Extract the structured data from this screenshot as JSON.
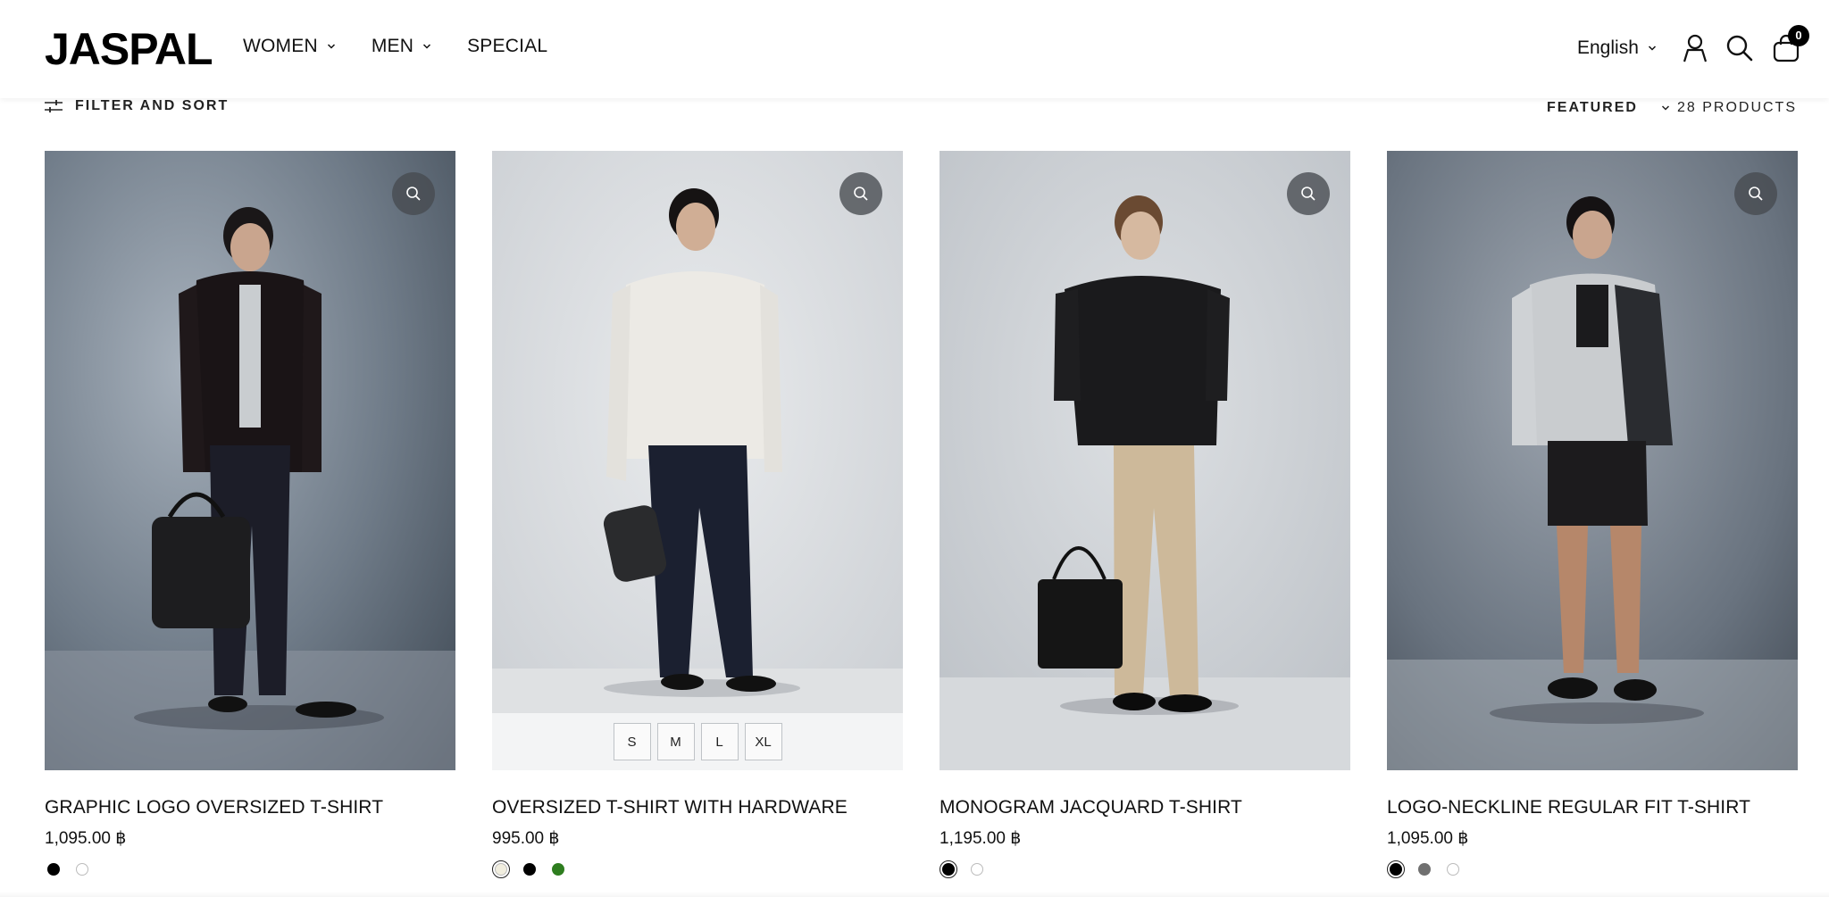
{
  "brand": {
    "logo": "JASPAL"
  },
  "nav": {
    "items": [
      {
        "label": "WOMEN",
        "has_dropdown": true
      },
      {
        "label": "MEN",
        "has_dropdown": true
      },
      {
        "label": "SPECIAL",
        "has_dropdown": false
      }
    ]
  },
  "header": {
    "language": "English",
    "icons": [
      "account-icon",
      "search-icon",
      "cart-icon"
    ],
    "cart_count": "0"
  },
  "toolbar": {
    "filter_label": "FILTER AND SORT",
    "sort_label": "FEATURED",
    "product_count": "28 PRODUCTS"
  },
  "products": [
    {
      "title": "GRAPHIC LOGO OVERSIZED T-SHIRT",
      "price": "1,095.00 ฿",
      "swatches": [
        {
          "color": "#000000",
          "selected": false
        },
        {
          "color": "#ffffff",
          "selected": false
        }
      ],
      "sizes": []
    },
    {
      "title": "OVERSIZED T-SHIRT WITH HARDWARE",
      "price": "995.00 ฿",
      "swatches": [
        {
          "color": "#f1eedf",
          "selected": true
        },
        {
          "color": "#000000",
          "selected": false
        },
        {
          "color": "#2e7d1f",
          "selected": false
        }
      ],
      "sizes": [
        "S",
        "M",
        "L",
        "XL"
      ]
    },
    {
      "title": "MONOGRAM JACQUARD T-SHIRT",
      "price": "1,195.00 ฿",
      "swatches": [
        {
          "color": "#000000",
          "selected": true
        },
        {
          "color": "#ffffff",
          "selected": false
        }
      ],
      "sizes": []
    },
    {
      "title": "LOGO-NECKLINE REGULAR FIT T-SHIRT",
      "price": "1,095.00 ฿",
      "swatches": [
        {
          "color": "#000000",
          "selected": true
        },
        {
          "color": "#707070",
          "selected": false
        },
        {
          "color": "#ffffff",
          "selected": false
        }
      ],
      "sizes": []
    }
  ]
}
